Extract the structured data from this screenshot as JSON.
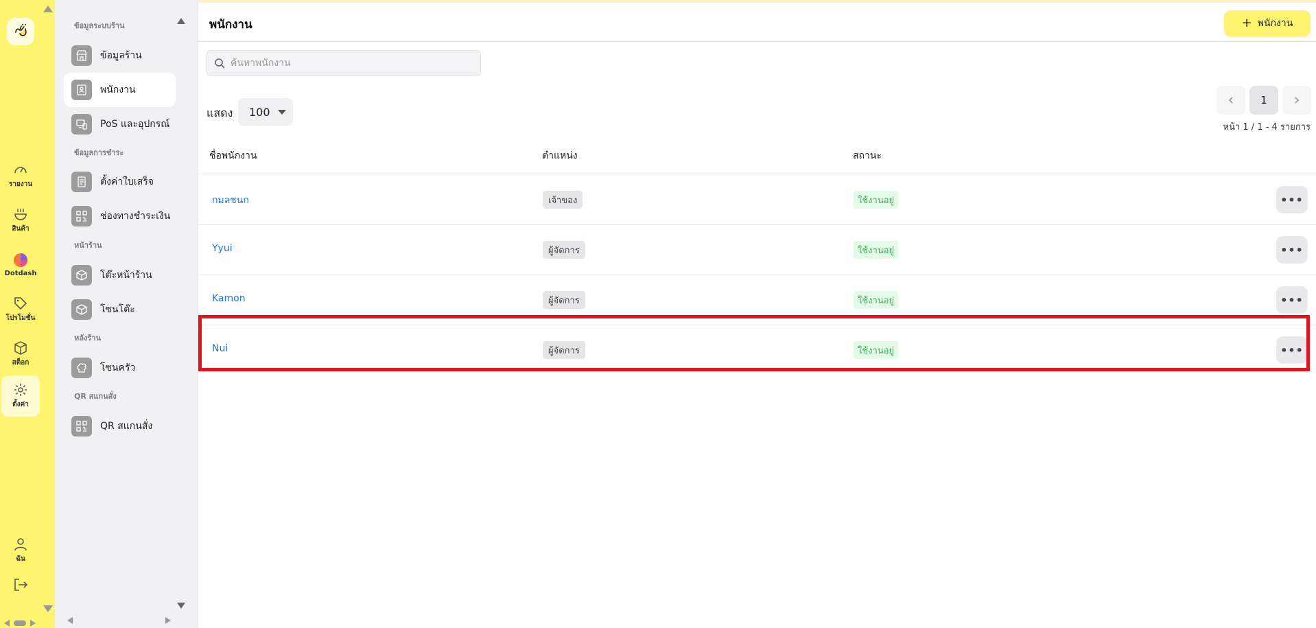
{
  "rail": {
    "items": [
      {
        "label": "รายงาน",
        "icon": "gauge-icon"
      },
      {
        "label": "สินค้า",
        "icon": "food-bowl-icon"
      },
      {
        "label": "Dotdash",
        "icon": "dotdash-icon"
      },
      {
        "label": "โปรโมชั่น",
        "icon": "tag-icon"
      },
      {
        "label": "สต็อก",
        "icon": "box-icon"
      },
      {
        "label": "ตั้งค่า",
        "icon": "gear-icon"
      }
    ],
    "user_label": "ฉัน",
    "active": "ตั้งค่า"
  },
  "sub_sidebar": {
    "sections": [
      {
        "title": "ข้อมูลระบบร้าน"
      },
      {
        "title": "ข้อมูลการชำระ"
      },
      {
        "title": "หน้าร้าน"
      },
      {
        "title": "หลังร้าน"
      },
      {
        "title": "QR สแกนสั่ง"
      }
    ],
    "items": [
      {
        "label": "ข้อมูลร้าน",
        "icon": "store-icon"
      },
      {
        "label": "พนักงาน",
        "icon": "badge-icon"
      },
      {
        "label": "PoS และอุปกรณ์",
        "icon": "devices-icon"
      },
      {
        "label": "ตั้งค่าใบเสร็จ",
        "icon": "receipt-icon"
      },
      {
        "label": "ช่องทางชำระเงิน",
        "icon": "qr-icon"
      },
      {
        "label": "โต๊ะหน้าร้าน",
        "icon": "cube-icon"
      },
      {
        "label": "โซนโต๊ะ",
        "icon": "cube-icon"
      },
      {
        "label": "โซนครัว",
        "icon": "chef-hat-icon"
      },
      {
        "label": "QR สแกนสั่ง",
        "icon": "qr-icon"
      }
    ]
  },
  "main": {
    "title": "พนักงาน",
    "add_button": "พนักงาน",
    "search_placeholder": "ค้นหาพนักงาน",
    "show_label": "แสดง",
    "page_size": "100",
    "current_page": "1",
    "page_info": "หน้า 1 / 1 - 4 รายการ",
    "columns": [
      "ชื่อพนักงาน",
      "ตำแหน่ง",
      "สถานะ"
    ],
    "rows": [
      {
        "name": "กมลชนก",
        "role": "เจ้าของ",
        "status": "ใช้งานอยู่"
      },
      {
        "name": "Yyui",
        "role": "ผู้จัดการ",
        "status": "ใช้งานอยู่"
      },
      {
        "name": "Kamon",
        "role": "ผู้จัดการ",
        "status": "ใช้งานอยู่"
      },
      {
        "name": "Nui",
        "role": "ผู้จัดการ",
        "status": "ใช้งานอยู่"
      }
    ],
    "more_label": "•••"
  },
  "colors": {
    "accent": "#fff46f",
    "link": "#1d74d6",
    "status_bg": "#e3fbe7",
    "status_text": "#39b15a",
    "highlight": "#e0141b"
  }
}
